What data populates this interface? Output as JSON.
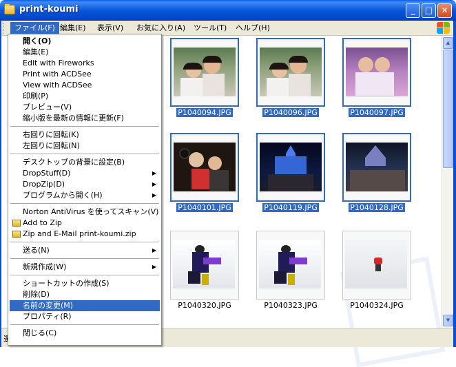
{
  "window": {
    "title": "print-koumi",
    "minimize": "_",
    "maximize": "□",
    "close": "✕"
  },
  "menubar": {
    "items": [
      "ファイル(F)",
      "編集(E)",
      "表示(V)",
      "お気に入り(A)",
      "ツール(T)",
      "ヘルプ(H)"
    ],
    "active_index": 0
  },
  "file_menu": {
    "items": [
      {
        "label": "開く(O)",
        "bold": true
      },
      {
        "label": "編集(E)"
      },
      {
        "label": "Edit with Fireworks"
      },
      {
        "label": "Print with ACDSee"
      },
      {
        "label": "View with ACDSee"
      },
      {
        "label": "印刷(P)"
      },
      {
        "label": "プレビュー(V)"
      },
      {
        "label": "縮小版を最新の情報に更新(F)"
      },
      {
        "separator": true
      },
      {
        "label": "右回りに回転(K)"
      },
      {
        "label": "左回りに回転(N)"
      },
      {
        "separator": true
      },
      {
        "label": "デスクトップの背景に設定(B)"
      },
      {
        "label": "DropStuff(D)",
        "submenu": true
      },
      {
        "label": "DropZip(D)",
        "submenu": true
      },
      {
        "label": "プログラムから開く(H)",
        "submenu": true
      },
      {
        "separator": true
      },
      {
        "label": "Norton AntiVirus を使ってスキャン(V)"
      },
      {
        "label": "Add to Zip",
        "icon": "zip-icon"
      },
      {
        "label": "Zip and E-Mail print-koumi.zip",
        "icon": "zip-icon"
      },
      {
        "separator": true
      },
      {
        "label": "送る(N)",
        "submenu": true
      },
      {
        "separator": true
      },
      {
        "label": "新規作成(W)",
        "submenu": true
      },
      {
        "separator": true
      },
      {
        "label": "ショートカットの作成(S)"
      },
      {
        "label": "削除(D)"
      },
      {
        "label": "名前の変更(M)",
        "highlighted": true
      },
      {
        "label": "プロパティ(R)"
      },
      {
        "separator": true
      },
      {
        "label": "閉じる(C)"
      }
    ]
  },
  "thumbnails": [
    {
      "name": "P1040094.JPG",
      "selected": true,
      "scene": "girls-light"
    },
    {
      "name": "P1040096.JPG",
      "selected": true,
      "scene": "girls-light"
    },
    {
      "name": "P1040097.JPG",
      "selected": true,
      "scene": "girls-pink"
    },
    {
      "name": "P1040101.JPG",
      "selected": true,
      "scene": "mickey"
    },
    {
      "name": "P1040119.JPG",
      "selected": true,
      "scene": "castle-night"
    },
    {
      "name": "P1040128.JPG",
      "selected": true,
      "scene": "group-night"
    },
    {
      "name": "P1040320.JPG",
      "selected": false,
      "scene": "ski-kid"
    },
    {
      "name": "P1040323.JPG",
      "selected": false,
      "scene": "ski-kid"
    },
    {
      "name": "P1040324.JPG",
      "selected": false,
      "scene": "ski-far"
    }
  ],
  "status": {
    "text": "選"
  },
  "colors": {
    "selection": "#316ac5",
    "titlebar": "#0a57d9",
    "menubar": "#ece9d8"
  }
}
